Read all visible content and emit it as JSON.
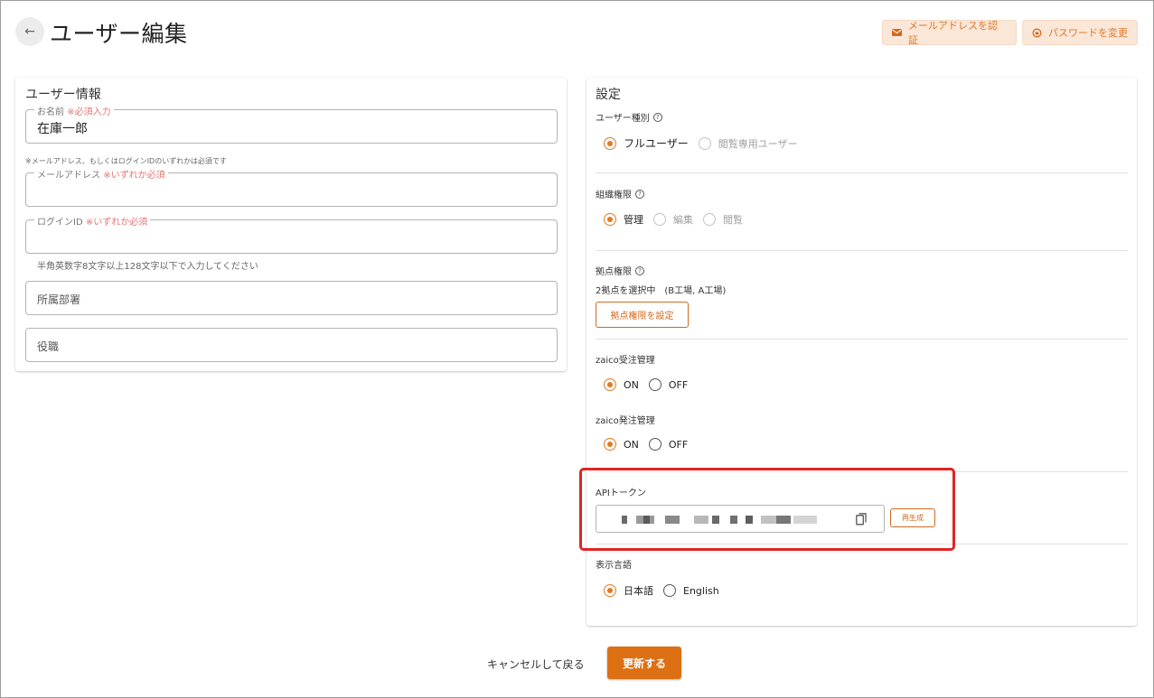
{
  "header": {
    "title": "ユーザー編集",
    "verify_email_label": "メールアドレスを認証",
    "change_password_label": "パスワードを変更"
  },
  "user_info": {
    "title": "ユーザー情報",
    "name_label": "お名前",
    "name_required": "※必須入力",
    "name_value": "在庫一郎",
    "email_or_login_note": "※メールアドレス、もしくはログインIDのいずれかは必須です",
    "email_label": "メールアドレス",
    "either_required": "※いずれか必須",
    "email_value": "",
    "login_label": "ログインID",
    "login_value": "",
    "login_helper": "半角英数字8文字以上128文字以下で入力してください",
    "department_placeholder": "所属部署",
    "position_placeholder": "役職"
  },
  "settings": {
    "title": "設定",
    "user_type": {
      "label": "ユーザー種別",
      "options": [
        "フルユーザー",
        "閲覧専用ユーザー"
      ],
      "selected": "フルユーザー"
    },
    "org_permission": {
      "label": "組織権限",
      "options": [
        "管理",
        "編集",
        "閲覧"
      ],
      "selected": "管理"
    },
    "base_permission": {
      "label": "拠点権限",
      "status": "2拠点を選択中　(B工場, A工場)",
      "button_label": "拠点権限を設定"
    },
    "order_receive": {
      "label": "zaico受注管理",
      "options": [
        "ON",
        "OFF"
      ],
      "selected": "ON"
    },
    "order_place": {
      "label": "zaico発注管理",
      "options": [
        "ON",
        "OFF"
      ],
      "selected": "ON"
    },
    "api_token": {
      "label": "APIトークン",
      "regenerate_label": "再生成"
    },
    "language": {
      "label": "表示言語",
      "options": [
        "日本語",
        "English"
      ],
      "selected": "日本語"
    }
  },
  "footer": {
    "cancel_label": "キャンセルして戻る",
    "submit_label": "更新する"
  },
  "colors": {
    "accent": "#de7014",
    "accent_light": "#fbe7d8",
    "highlight": "#e02424"
  }
}
